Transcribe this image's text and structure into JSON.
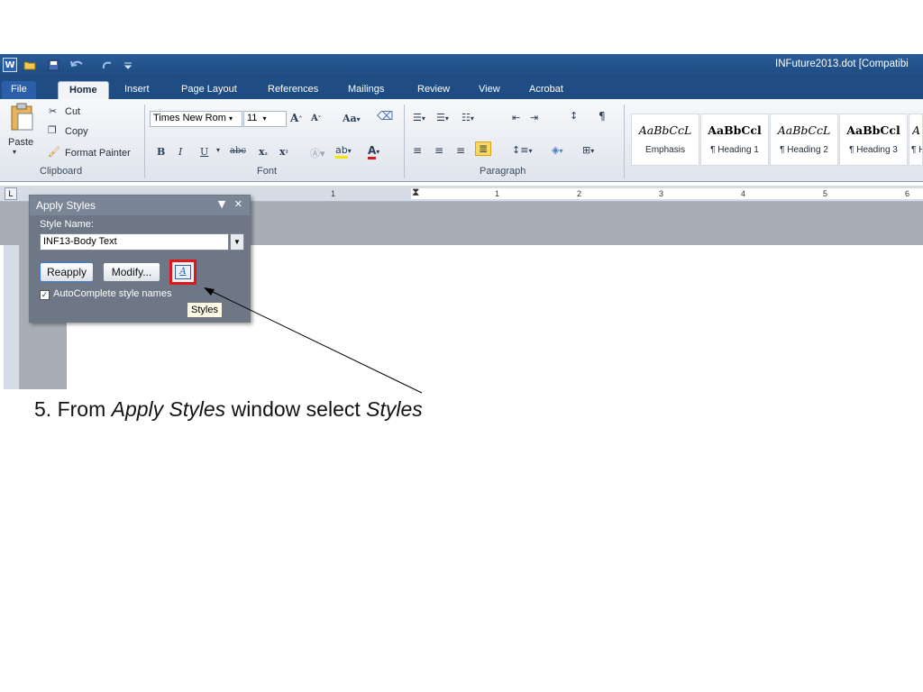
{
  "app": {
    "title": "INFuture2013.dot [Compatibi",
    "word_icon": "W",
    "qat_icons": [
      "folder-icon",
      "save-icon",
      "undo-icon",
      "redo-icon",
      "customize-icon"
    ]
  },
  "tabs": [
    "File",
    "Home",
    "Insert",
    "Page Layout",
    "References",
    "Mailings",
    "Review",
    "View",
    "Acrobat"
  ],
  "active_tab": "Home",
  "ribbon": {
    "clipboard": {
      "paste": "Paste",
      "cut": "Cut",
      "copy": "Copy",
      "format_painter": "Format Painter",
      "label": "Clipboard"
    },
    "font": {
      "font_name": "Times New Rom",
      "font_size": "11",
      "label": "Font"
    },
    "paragraph": {
      "label": "Paragraph"
    },
    "styles": [
      {
        "sample": "AaBbCcL",
        "name": "Emphasis"
      },
      {
        "sample": "AaBbCcl",
        "name": "¶ Heading 1"
      },
      {
        "sample": "AaBbCcL",
        "name": "¶ Heading 2"
      },
      {
        "sample": "AaBbCcl",
        "name": "¶ Heading 3"
      },
      {
        "sample": "A",
        "name": "¶ H"
      }
    ]
  },
  "ruler": {
    "numbers": [
      "1",
      "1",
      "2",
      "3",
      "4",
      "5",
      "6"
    ]
  },
  "apply_styles": {
    "title": "Apply Styles",
    "style_name_label": "Style Name:",
    "style_name_value": "INF13-Body Text",
    "reapply": "Reapply",
    "modify": "Modify...",
    "styles_icon": "A",
    "autocomplete_label": "AutoComplete style names",
    "autocomplete_checked": "✓",
    "tooltip": "Styles"
  },
  "caption": {
    "prefix": "5. From ",
    "em1": "Apply Styles",
    "middle": " window select ",
    "em2": "Styles"
  },
  "colors": {
    "highlight_border": "#e0161b",
    "titlebar": "#2a5c97"
  }
}
